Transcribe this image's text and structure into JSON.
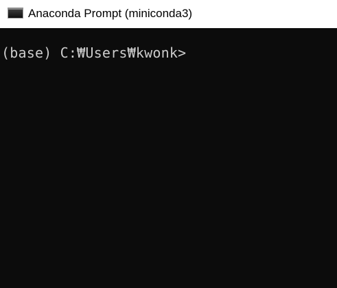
{
  "window": {
    "title": "Anaconda Prompt (miniconda3)",
    "icon": "console-window-icon"
  },
  "console": {
    "prompt": "(base) C:₩Users₩kwonk>"
  },
  "colors": {
    "titlebar_background": "#ffffff",
    "console_background": "#0c0c0c",
    "console_text": "#cccccc"
  }
}
